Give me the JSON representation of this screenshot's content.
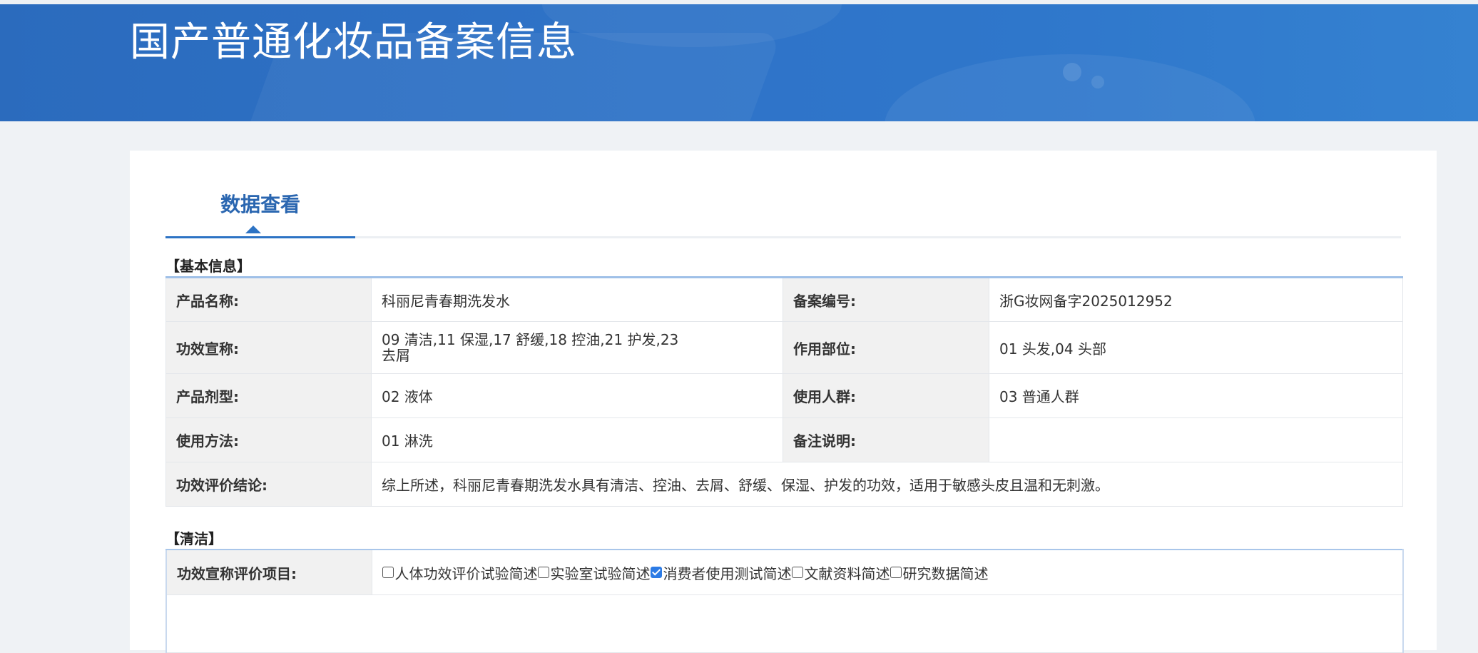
{
  "header": {
    "title": "国产普通化妆品备案信息"
  },
  "tabs": [
    {
      "label": "数据查看",
      "active": true
    }
  ],
  "basic_info": {
    "section_title": "【基本信息】",
    "product_name_label": "产品名称:",
    "product_name": "科丽尼青春期洗发水",
    "record_no_label": "备案编号:",
    "record_no": "浙G妆网备字2025012952",
    "efficacy_label": "功效宣称:",
    "efficacy_line1": "09 清洁,11 保湿,17 舒缓,18 控油,21 护发,23",
    "efficacy_line2": "去屑",
    "application_area_label": "作用部位:",
    "application_area": "01 头发,04 头部",
    "dosage_form_label": "产品剂型:",
    "dosage_form": "02 液体",
    "target_group_label": "使用人群:",
    "target_group": "03 普通人群",
    "usage_label": "使用方法:",
    "usage": "01 淋洗",
    "remarks_label": "备注说明:",
    "remarks": "",
    "conclusion_label": "功效评价结论:",
    "conclusion": "综上所述，科丽尼青春期洗发水具有清洁、控油、去屑、舒缓、保湿、护发的功效，适用于敏感头皮且温和无刺激。"
  },
  "clean": {
    "section_title": "【清洁】",
    "items_label": "功效宣称评价项目:",
    "options": [
      {
        "label": "人体功效评价试验简述",
        "checked": false
      },
      {
        "label": "实验室试验简述",
        "checked": false
      },
      {
        "label": "消费者使用测试简述",
        "checked": true
      },
      {
        "label": "文献资料简述",
        "checked": false
      },
      {
        "label": "研究数据简述",
        "checked": false
      }
    ]
  },
  "colors": {
    "header_blue": "#2f73c8",
    "tab_active": "#2a66b0",
    "checkbox_checked": "#2c7be5",
    "label_bg": "#f1f1f1"
  }
}
